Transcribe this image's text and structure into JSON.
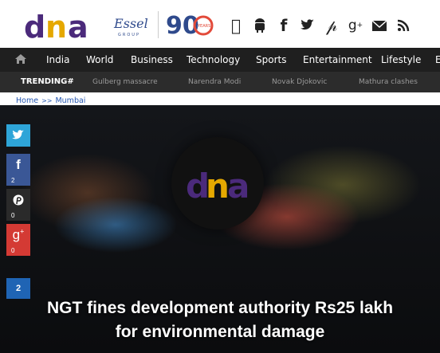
{
  "brand": {
    "logo_text": "dna",
    "partner": "Essel",
    "partner_sub": "GROUP",
    "anniversary": "90",
    "anniversary_sub": "YEARS"
  },
  "top_social": [
    "apple-icon",
    "android-icon",
    "facebook-icon",
    "twitter-icon",
    "pinterest-icon",
    "google-plus-icon",
    "email-icon",
    "rss-icon"
  ],
  "nav": {
    "items": [
      "India",
      "World",
      "Business",
      "Technology",
      "Sports",
      "Entertainment",
      "Lifestyle",
      "E"
    ]
  },
  "trending": {
    "label": "TRENDING#",
    "items": [
      "Gulberg massacre",
      "Narendra Modi",
      "Novak Djokovic",
      "Mathura clashes"
    ]
  },
  "breadcrumb": {
    "home": "Home",
    "separator": ">>",
    "section": "Mumbai"
  },
  "share": {
    "facebook_count": "2",
    "pinterest_count": "0",
    "google_plus_count": "0",
    "total": "2"
  },
  "article": {
    "headline_line1": "NGT fines development authority Rs25 lakh",
    "headline_line2": "for environmental damage"
  },
  "colors": {
    "brand_purple": "#4b2a7b",
    "brand_orange": "#e5a800",
    "twitter": "#2ea5d8",
    "facebook": "#3a5796",
    "pinterest": "#2a2a2a",
    "google_plus": "#d43a34"
  }
}
